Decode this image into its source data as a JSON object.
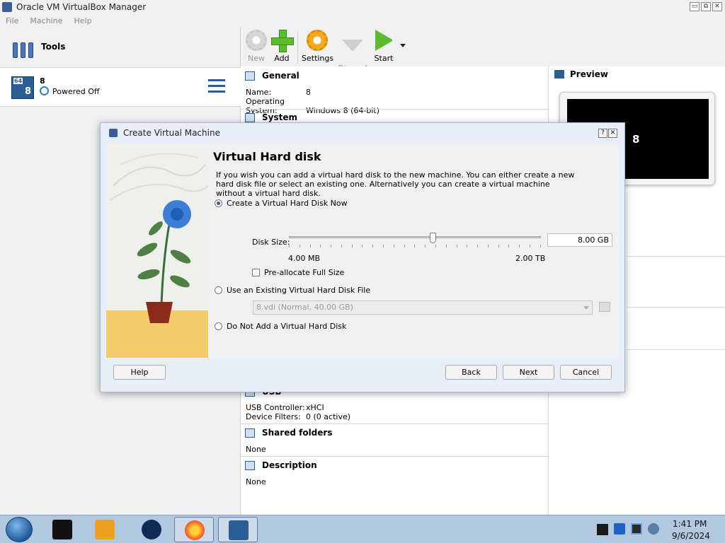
{
  "window": {
    "title": "Oracle VM VirtualBox Manager",
    "controls": [
      "▭",
      "⧉",
      "✕"
    ]
  },
  "menu": [
    "File",
    "Machine",
    "Help"
  ],
  "tools": {
    "label": "Tools"
  },
  "vm": {
    "name": "8",
    "state": "Powered Off",
    "os_badge_bits": "64",
    "os_badge_version": "8"
  },
  "toolbar": {
    "new": "New",
    "add": "Add",
    "settings": "Settings",
    "discard": "Discard",
    "start": "Start"
  },
  "details": {
    "general": {
      "title": "General",
      "name_key": "Name:",
      "name_val": "8",
      "os_key": "Operating System:",
      "os_val": "Windows 8 (64-bit)"
    },
    "system": {
      "title": "System"
    },
    "usb": {
      "title": "USB",
      "controller_key": "USB Controller:",
      "controller_val": "xHCI",
      "filters_key": "Device Filters:",
      "filters_val": "0 (0 active)"
    },
    "shared_folders": {
      "title": "Shared folders",
      "value": "None"
    },
    "description": {
      "title": "Description",
      "value": "None"
    }
  },
  "preview": {
    "title": "Preview",
    "screen_text": "8"
  },
  "dialog": {
    "title": "Create Virtual Machine",
    "controls": [
      "?",
      "✕"
    ],
    "heading": "Virtual Hard disk",
    "intro": "If you wish you can add a virtual hard disk to the new machine. You can either create a new hard disk file or select an existing one. Alternatively you can create a virtual machine without a virtual hard disk.",
    "options": {
      "create": "Create a Virtual Hard Disk Now",
      "existing": "Use an Existing Virtual Hard Disk File",
      "none": "Do Not Add a Virtual Hard Disk"
    },
    "selected_option": "create",
    "disk_size": {
      "label": "Disk Size:",
      "value": "8.00 GB",
      "min_label": "4.00 MB",
      "max_label": "2.00 TB",
      "slider_position": 0.57
    },
    "preallocate": {
      "label": "Pre-allocate Full Size",
      "checked": false
    },
    "existing_file": "8.vdi (Normal, 40.00 GB)",
    "buttons": {
      "help": "Help",
      "back": "Back",
      "next": "Next",
      "cancel": "Cancel"
    }
  },
  "taskbar": {
    "time": "1:41 PM",
    "date": "9/6/2024"
  },
  "colors": {
    "accent": "#2b5d96",
    "dialog_bg": "#e8eef7",
    "taskbar": "#b2c8de",
    "art_floor": "#f2cb6b"
  }
}
